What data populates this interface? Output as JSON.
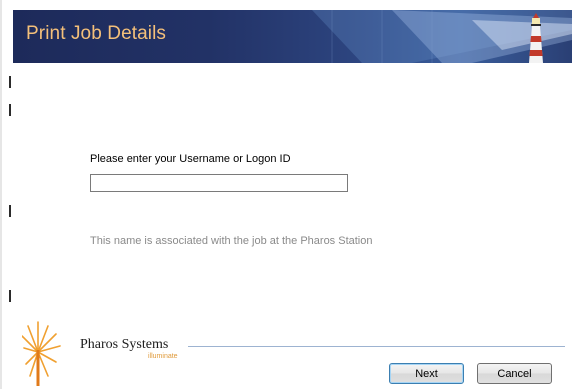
{
  "header": {
    "title": "Print Job Details",
    "logo_icon": "lighthouse-icon"
  },
  "form": {
    "prompt_label": "Please enter your Username or Logon ID",
    "username_value": "",
    "hint": "This name is associated with the job at the Pharos Station"
  },
  "branding": {
    "logo_icon": "starburst-logo-icon",
    "company_name": "Pharos Systems",
    "tagline": "illuminate"
  },
  "buttons": {
    "next_label": "Next",
    "cancel_label": "Cancel"
  },
  "colors": {
    "header_background": "#223266",
    "header_title": "#f4c07a",
    "hint_text": "#8a8a8a",
    "tagline": "#e09a3a",
    "default_button_border": "#3c7fb1"
  }
}
